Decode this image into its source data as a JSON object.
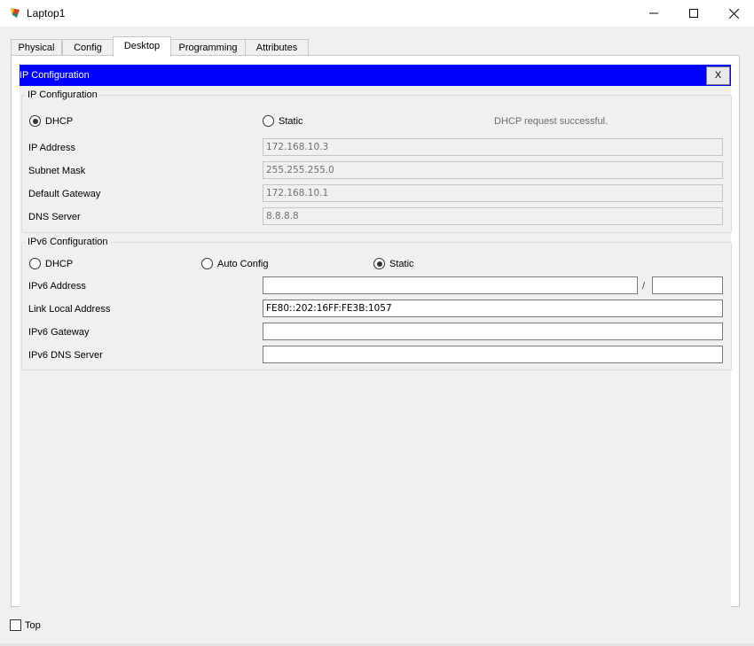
{
  "window": {
    "title": "Laptop1",
    "minimize_glyph": "—",
    "maximize_glyph": "☐",
    "close_glyph": "✕"
  },
  "tabs": [
    {
      "label": "Physical"
    },
    {
      "label": "Config"
    },
    {
      "label": "Desktop",
      "active": true
    },
    {
      "label": "Programming"
    },
    {
      "label": "Attributes"
    }
  ],
  "panel": {
    "title": "IP Configuration",
    "close_label": "X"
  },
  "ipv4": {
    "legend": "IP Configuration",
    "dhcp_label": "DHCP",
    "static_label": "Static",
    "mode": "DHCP",
    "status": "DHCP request successful.",
    "ip_address_label": "IP Address",
    "ip_address": "172.168.10.3",
    "subnet_mask_label": "Subnet Mask",
    "subnet_mask": "255.255.255.0",
    "gateway_label": "Default Gateway",
    "gateway": "172.168.10.1",
    "dns_label": "DNS Server",
    "dns": "8.8.8.8"
  },
  "ipv6": {
    "legend": "IPv6 Configuration",
    "dhcp_label": "DHCP",
    "auto_label": "Auto Config",
    "static_label": "Static",
    "mode": "Static",
    "address_label": "IPv6 Address",
    "address": "",
    "prefix_separator": "/",
    "prefix": "",
    "link_local_label": "Link Local Address",
    "link_local": "FE80::202:16FF:FE3B:1057",
    "gateway_label": "IPv6 Gateway",
    "gateway": "",
    "dns_label": "IPv6 DNS Server",
    "dns": ""
  },
  "footer": {
    "top_label": "Top",
    "top_checked": false
  },
  "colors": {
    "title_bar_accent": "#0000ff",
    "background": "#f0f0f0"
  },
  "icons": {
    "app": "packet-tracer-laptop-icon"
  }
}
